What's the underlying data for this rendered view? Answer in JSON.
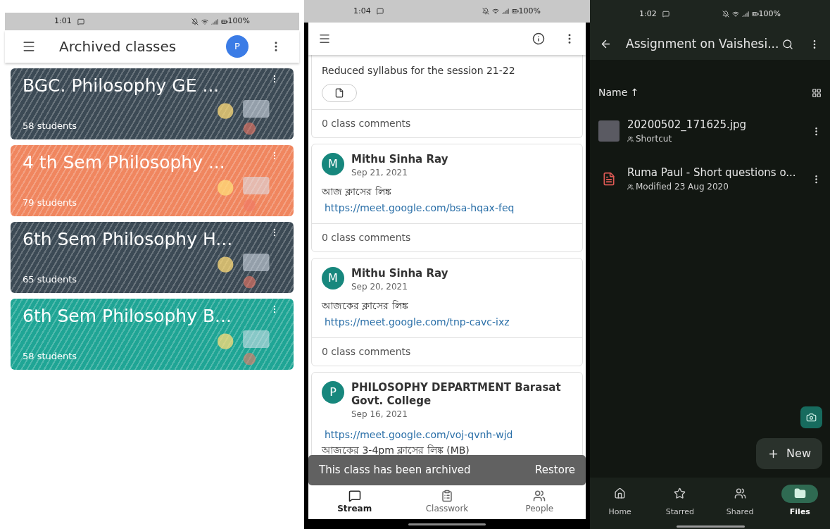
{
  "classes_screen": {
    "status_bar": {
      "time": "1:01",
      "battery": "100%"
    },
    "app_bar": {
      "title": "Archived classes",
      "avatar_letter": "P"
    },
    "classes": [
      {
        "name": "BGC. Philosophy GE ...",
        "students": "58 students",
        "color": "#3c4a55"
      },
      {
        "name": "4 th Sem Philosophy ...",
        "students": "79 students",
        "color": "#f0865f"
      },
      {
        "name": "6th Sem Philosophy H...",
        "students": "65 students",
        "color": "#3c4a55"
      },
      {
        "name": "6th Sem Philosophy B...",
        "students": "58 students",
        "color": "#1fa595"
      }
    ]
  },
  "class_stream_screen": {
    "status_bar": {
      "time": "1:04",
      "battery": "100%"
    },
    "posts": [
      {
        "kind": "partial",
        "lines": [
          {
            "kind": "text",
            "text": "Reduced syllabus for the session 21-22"
          }
        ],
        "attachment": true,
        "comments": "0 class comments"
      },
      {
        "kind": "full",
        "avatar_letter": "M",
        "author": "Mithu Sinha Ray",
        "date": "Sep 21, 2021",
        "lines": [
          {
            "kind": "text",
            "text": "আজ ক্লাসের লিঙ্ক"
          },
          {
            "kind": "link",
            "text": "https://meet.google.com/bsa-hqax-feq"
          }
        ],
        "attachment": false,
        "comments": "0 class comments"
      },
      {
        "kind": "full",
        "avatar_letter": "M",
        "author": "Mithu Sinha Ray",
        "date": "Sep 20, 2021",
        "lines": [
          {
            "kind": "text",
            "text": "আজকের ক্লাসের লিঙ্ক"
          },
          {
            "kind": "link",
            "text": "https://meet.google.com/tnp-cavc-ixz"
          }
        ],
        "attachment": false,
        "comments": "0 class comments"
      },
      {
        "kind": "full",
        "avatar_letter": "P",
        "author": "PHILOSOPHY DEPARTMENT Barasat Govt. College",
        "date": "Sep 16, 2021",
        "lines": [
          {
            "kind": "link",
            "text": "https://meet.google.com/voj-qvnh-wjd"
          },
          {
            "kind": "text",
            "text": "আজকের 3-4pm ক্লাসের লিঙ্ক (MB)"
          }
        ],
        "attachment": false
      }
    ],
    "snackbar": {
      "message": "This class has been archived",
      "action": "Restore"
    },
    "nav": [
      {
        "label": "Stream",
        "kind": "stream",
        "selected": true
      },
      {
        "label": "Classwork",
        "kind": "classwork",
        "selected": false
      },
      {
        "label": "People",
        "kind": "people",
        "selected": false
      }
    ]
  },
  "drive_screen": {
    "status_bar": {
      "time": "1:02",
      "battery": "100%"
    },
    "title": "Assignment on Vaishesi...",
    "sort_label": "Name ↑",
    "files": [
      {
        "kind": "image",
        "name": "20200502_171625.jpg",
        "detail": "Shortcut"
      },
      {
        "kind": "pdf",
        "name": "Ruma Paul - Short questions o...",
        "detail": "Modified 23 Aug 2020"
      }
    ],
    "new_button": "New",
    "nav": [
      {
        "label": "Home",
        "kind": "home",
        "selected": false
      },
      {
        "label": "Starred",
        "kind": "starred",
        "selected": false
      },
      {
        "label": "Shared",
        "kind": "shared",
        "selected": false
      },
      {
        "label": "Files",
        "kind": "files",
        "selected": true
      }
    ]
  }
}
